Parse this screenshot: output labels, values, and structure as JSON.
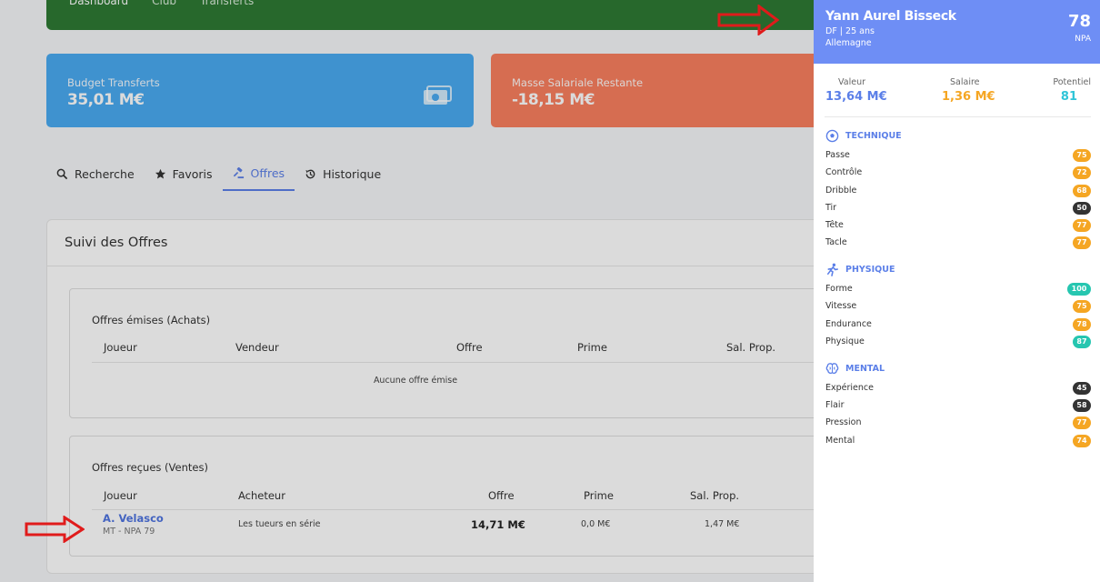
{
  "nav": {
    "items": [
      "Dashboard",
      "Club",
      "Transferts"
    ]
  },
  "cards": {
    "budget": {
      "label": "Budget Transferts",
      "value": "35,01 M€"
    },
    "masse": {
      "label": "Masse Salariale Restante",
      "value": "-18,15 M€"
    }
  },
  "tabs": [
    {
      "label": "Recherche",
      "icon": "search-icon"
    },
    {
      "label": "Favoris",
      "icon": "star-icon"
    },
    {
      "label": "Offres",
      "icon": "gavel-icon",
      "active": true
    },
    {
      "label": "Historique",
      "icon": "history-icon"
    }
  ],
  "offers": {
    "title": "Suivi des Offres",
    "emises": {
      "title": "Offres émises (Achats)",
      "headers": [
        "Joueur",
        "Vendeur",
        "Offre",
        "Prime",
        "Sal. Prop."
      ],
      "empty": "Aucune offre émise"
    },
    "recues": {
      "title": "Offres reçues (Ventes)",
      "headers": [
        "Joueur",
        "Acheteur",
        "Offre",
        "Prime",
        "Sal. Prop."
      ],
      "row": {
        "player": "A. Velasco",
        "sub": "MT - NPA 79",
        "buyer": "Les tueurs en série",
        "offer": "14,71 M€",
        "prime": "0,0 M€",
        "salary": "1,47 M€"
      }
    }
  },
  "player": {
    "name": "Yann Aurel Bisseck",
    "pos_age": "DF | 25 ans",
    "country": "Allemagne",
    "npa": "78",
    "npa_label": "NPA",
    "valeur_label": "Valeur",
    "valeur": "13,64 M€",
    "salaire_label": "Salaire",
    "salaire": "1,36 M€",
    "potentiel_label": "Potentiel",
    "potentiel": "81",
    "technique": {
      "title": "TECHNIQUE",
      "attrs": [
        {
          "label": "Passe",
          "value": "75"
        },
        {
          "label": "Contrôle",
          "value": "72"
        },
        {
          "label": "Dribble",
          "value": "68"
        },
        {
          "label": "Tir",
          "value": "50"
        },
        {
          "label": "Tête",
          "value": "77"
        },
        {
          "label": "Tacle",
          "value": "77"
        }
      ]
    },
    "physique": {
      "title": "PHYSIQUE",
      "attrs": [
        {
          "label": "Forme",
          "value": "100"
        },
        {
          "label": "Vitesse",
          "value": "75"
        },
        {
          "label": "Endurance",
          "value": "78"
        },
        {
          "label": "Physique",
          "value": "87"
        }
      ]
    },
    "mental": {
      "title": "MENTAL",
      "attrs": [
        {
          "label": "Expérience",
          "value": "45"
        },
        {
          "label": "Flair",
          "value": "58"
        },
        {
          "label": "Pression",
          "value": "77"
        },
        {
          "label": "Mental",
          "value": "74"
        }
      ]
    }
  },
  "colors": {
    "accent": "#5b7fe8",
    "orange": "#f5a623",
    "dark": "#333333",
    "teal": "#26c6b0",
    "cyan": "#2fc5d8"
  }
}
